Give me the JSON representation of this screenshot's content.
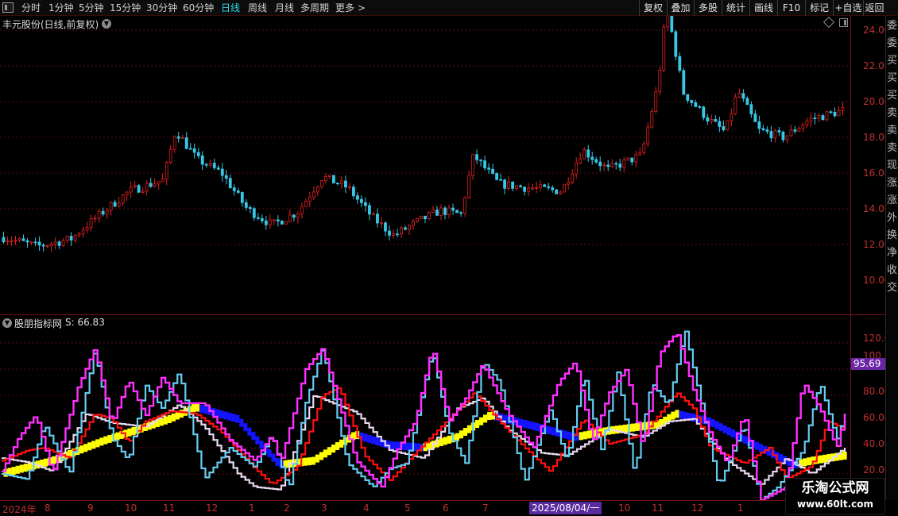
{
  "toolbar": {
    "periods": [
      "分时",
      "1分钟",
      "5分钟",
      "15分钟",
      "30分钟",
      "60分钟",
      "日线",
      "周线",
      "月线",
      "多周期",
      "更多 >"
    ],
    "active_period": "日线",
    "right_buttons": [
      "复权",
      "叠加",
      "多股",
      "统计",
      "画线",
      "F10",
      "标记",
      "+自选",
      "返回"
    ]
  },
  "main_panel": {
    "title": "丰元股份(日线,前复权)",
    "price_labels": [
      "24.00",
      "22.00",
      "20.00",
      "18.00",
      "16.00",
      "14.00",
      "12.00",
      "10.00"
    ]
  },
  "indicator_panel": {
    "name": "股朋指标网",
    "value_label": "S: 66.83",
    "scale_labels": [
      "120.0",
      "100",
      "80.00",
      "60.00",
      "40.00",
      "20.00"
    ],
    "current_value_flag": "95.69"
  },
  "date_axis": {
    "labels": [
      "2024年",
      "8",
      "9",
      "10",
      "11",
      "12",
      "1",
      "2",
      "3",
      "4",
      "5",
      "6",
      "7",
      "10",
      "11",
      "12",
      "1"
    ],
    "cursor_date": "2025/08/04/一"
  },
  "side_strip": {
    "chars": [
      "委",
      "委",
      "买",
      "买",
      "买",
      "卖",
      "卖",
      "卖",
      "现",
      "涨",
      "涨",
      "外",
      "换",
      "净",
      "收",
      "交"
    ]
  },
  "watermark": {
    "title": "乐淘公式网",
    "url": "www.60lt.com"
  },
  "colors": {
    "up_candle": "#e02020",
    "down_candle": "#36c8e6",
    "grid": "#5a0c0c",
    "magenta_line": "#ff30ff",
    "cyan_line": "#66ccf2",
    "red_line": "#ff1010",
    "white_line": "#e8d8f0",
    "yellow_band": "#ffff00",
    "blue_band": "#1414ff"
  }
}
